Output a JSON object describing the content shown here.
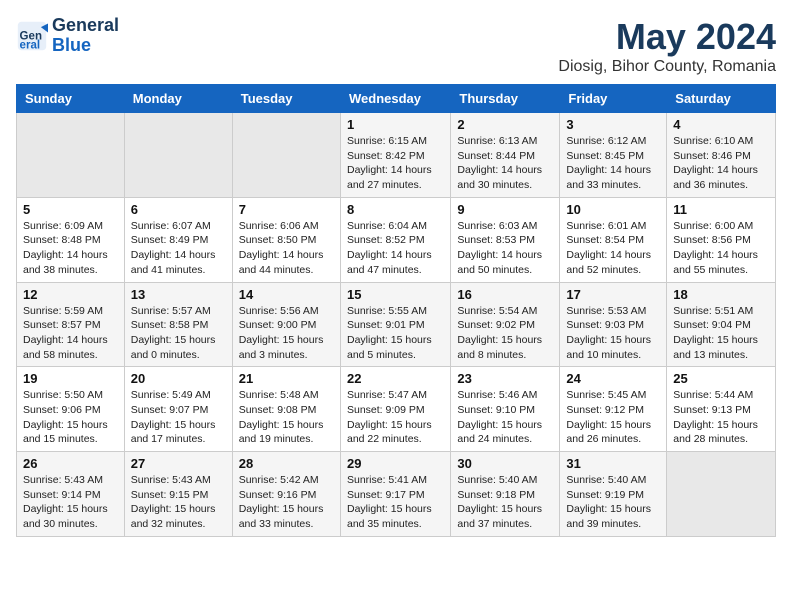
{
  "header": {
    "logo_line1": "General",
    "logo_line2": "Blue",
    "title": "May 2024",
    "subtitle": "Diosig, Bihor County, Romania"
  },
  "calendar": {
    "days_of_week": [
      "Sunday",
      "Monday",
      "Tuesday",
      "Wednesday",
      "Thursday",
      "Friday",
      "Saturday"
    ],
    "weeks": [
      [
        {
          "day": "",
          "info": ""
        },
        {
          "day": "",
          "info": ""
        },
        {
          "day": "",
          "info": ""
        },
        {
          "day": "1",
          "info": "Sunrise: 6:15 AM\nSunset: 8:42 PM\nDaylight: 14 hours\nand 27 minutes."
        },
        {
          "day": "2",
          "info": "Sunrise: 6:13 AM\nSunset: 8:44 PM\nDaylight: 14 hours\nand 30 minutes."
        },
        {
          "day": "3",
          "info": "Sunrise: 6:12 AM\nSunset: 8:45 PM\nDaylight: 14 hours\nand 33 minutes."
        },
        {
          "day": "4",
          "info": "Sunrise: 6:10 AM\nSunset: 8:46 PM\nDaylight: 14 hours\nand 36 minutes."
        }
      ],
      [
        {
          "day": "5",
          "info": "Sunrise: 6:09 AM\nSunset: 8:48 PM\nDaylight: 14 hours\nand 38 minutes."
        },
        {
          "day": "6",
          "info": "Sunrise: 6:07 AM\nSunset: 8:49 PM\nDaylight: 14 hours\nand 41 minutes."
        },
        {
          "day": "7",
          "info": "Sunrise: 6:06 AM\nSunset: 8:50 PM\nDaylight: 14 hours\nand 44 minutes."
        },
        {
          "day": "8",
          "info": "Sunrise: 6:04 AM\nSunset: 8:52 PM\nDaylight: 14 hours\nand 47 minutes."
        },
        {
          "day": "9",
          "info": "Sunrise: 6:03 AM\nSunset: 8:53 PM\nDaylight: 14 hours\nand 50 minutes."
        },
        {
          "day": "10",
          "info": "Sunrise: 6:01 AM\nSunset: 8:54 PM\nDaylight: 14 hours\nand 52 minutes."
        },
        {
          "day": "11",
          "info": "Sunrise: 6:00 AM\nSunset: 8:56 PM\nDaylight: 14 hours\nand 55 minutes."
        }
      ],
      [
        {
          "day": "12",
          "info": "Sunrise: 5:59 AM\nSunset: 8:57 PM\nDaylight: 14 hours\nand 58 minutes."
        },
        {
          "day": "13",
          "info": "Sunrise: 5:57 AM\nSunset: 8:58 PM\nDaylight: 15 hours\nand 0 minutes."
        },
        {
          "day": "14",
          "info": "Sunrise: 5:56 AM\nSunset: 9:00 PM\nDaylight: 15 hours\nand 3 minutes."
        },
        {
          "day": "15",
          "info": "Sunrise: 5:55 AM\nSunset: 9:01 PM\nDaylight: 15 hours\nand 5 minutes."
        },
        {
          "day": "16",
          "info": "Sunrise: 5:54 AM\nSunset: 9:02 PM\nDaylight: 15 hours\nand 8 minutes."
        },
        {
          "day": "17",
          "info": "Sunrise: 5:53 AM\nSunset: 9:03 PM\nDaylight: 15 hours\nand 10 minutes."
        },
        {
          "day": "18",
          "info": "Sunrise: 5:51 AM\nSunset: 9:04 PM\nDaylight: 15 hours\nand 13 minutes."
        }
      ],
      [
        {
          "day": "19",
          "info": "Sunrise: 5:50 AM\nSunset: 9:06 PM\nDaylight: 15 hours\nand 15 minutes."
        },
        {
          "day": "20",
          "info": "Sunrise: 5:49 AM\nSunset: 9:07 PM\nDaylight: 15 hours\nand 17 minutes."
        },
        {
          "day": "21",
          "info": "Sunrise: 5:48 AM\nSunset: 9:08 PM\nDaylight: 15 hours\nand 19 minutes."
        },
        {
          "day": "22",
          "info": "Sunrise: 5:47 AM\nSunset: 9:09 PM\nDaylight: 15 hours\nand 22 minutes."
        },
        {
          "day": "23",
          "info": "Sunrise: 5:46 AM\nSunset: 9:10 PM\nDaylight: 15 hours\nand 24 minutes."
        },
        {
          "day": "24",
          "info": "Sunrise: 5:45 AM\nSunset: 9:12 PM\nDaylight: 15 hours\nand 26 minutes."
        },
        {
          "day": "25",
          "info": "Sunrise: 5:44 AM\nSunset: 9:13 PM\nDaylight: 15 hours\nand 28 minutes."
        }
      ],
      [
        {
          "day": "26",
          "info": "Sunrise: 5:43 AM\nSunset: 9:14 PM\nDaylight: 15 hours\nand 30 minutes."
        },
        {
          "day": "27",
          "info": "Sunrise: 5:43 AM\nSunset: 9:15 PM\nDaylight: 15 hours\nand 32 minutes."
        },
        {
          "day": "28",
          "info": "Sunrise: 5:42 AM\nSunset: 9:16 PM\nDaylight: 15 hours\nand 33 minutes."
        },
        {
          "day": "29",
          "info": "Sunrise: 5:41 AM\nSunset: 9:17 PM\nDaylight: 15 hours\nand 35 minutes."
        },
        {
          "day": "30",
          "info": "Sunrise: 5:40 AM\nSunset: 9:18 PM\nDaylight: 15 hours\nand 37 minutes."
        },
        {
          "day": "31",
          "info": "Sunrise: 5:40 AM\nSunset: 9:19 PM\nDaylight: 15 hours\nand 39 minutes."
        },
        {
          "day": "",
          "info": ""
        }
      ]
    ]
  }
}
